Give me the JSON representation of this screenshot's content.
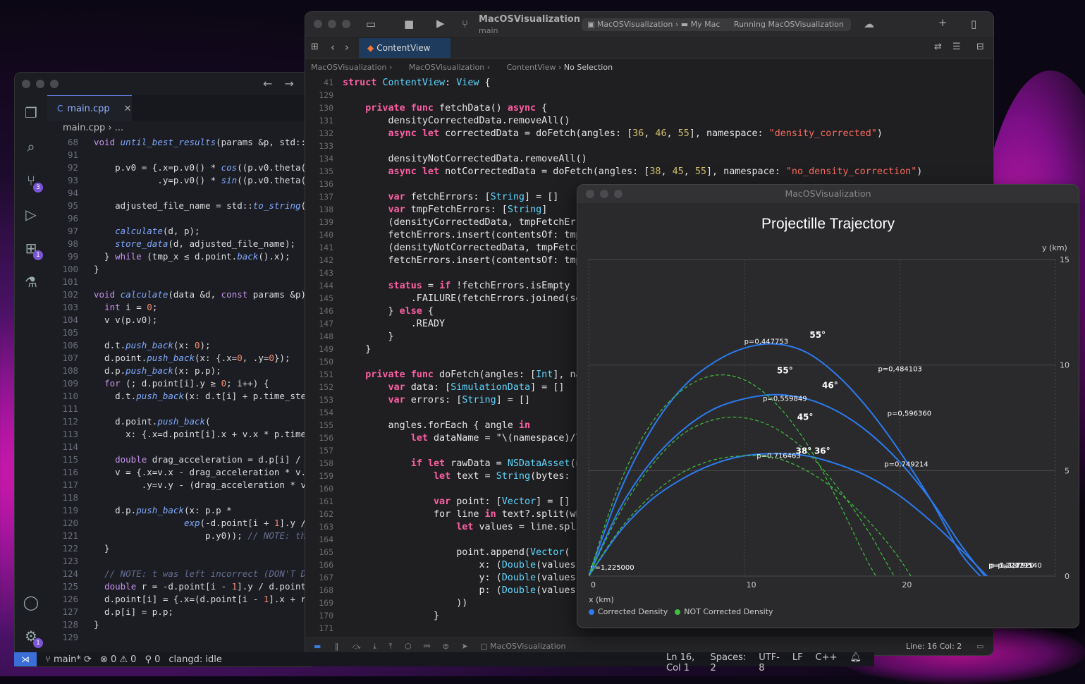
{
  "vscode": {
    "tab": {
      "name": "main.cpp"
    },
    "breadcrumb": "main.cpp  ›  ...",
    "badges": {
      "scm": "3",
      "extensions": "1",
      "settings": "1"
    },
    "code_lines": [
      {
        "n": "68",
        "t": "void until_best_results(params &p, std::st"
      },
      {
        "n": "91",
        "t": ""
      },
      {
        "n": "92",
        "t": "    p.v0 = {.x=p.v0() * cos((p.v0.theta()"
      },
      {
        "n": "93",
        "t": "            .y=p.v0() * sin((p.v0.theta()"
      },
      {
        "n": "94",
        "t": ""
      },
      {
        "n": "95",
        "t": "    adjusted_file_name = std::to_string(va"
      },
      {
        "n": "96",
        "t": ""
      },
      {
        "n": "97",
        "t": "    calculate(d, p);"
      },
      {
        "n": "98",
        "t": "    store_data(d, adjusted_file_name);"
      },
      {
        "n": "99",
        "t": "  } while (tmp_x ≤ d.point.back().x);"
      },
      {
        "n": "100",
        "t": "}"
      },
      {
        "n": "101",
        "t": ""
      },
      {
        "n": "102",
        "t": "void calculate(data &d, const params &p) {"
      },
      {
        "n": "103",
        "t": "  int i = 0;"
      },
      {
        "n": "104",
        "t": "  v v(p.v0);"
      },
      {
        "n": "105",
        "t": ""
      },
      {
        "n": "106",
        "t": "  d.t.push_back(x: 0);"
      },
      {
        "n": "107",
        "t": "  d.point.push_back(x: {.x=0, .y=0});"
      },
      {
        "n": "108",
        "t": "  d.p.push_back(x: p.p);"
      },
      {
        "n": "109",
        "t": "  for (; d.point[i].y ≥ 0; i++) {"
      },
      {
        "n": "110",
        "t": "    d.t.push_back(x: d.t[i] + p.time_step)"
      },
      {
        "n": "111",
        "t": ""
      },
      {
        "n": "112",
        "t": "    d.point.push_back("
      },
      {
        "n": "113",
        "t": "      x: {.x=d.point[i].x + v.x * p.time"
      },
      {
        "n": "114",
        "t": ""
      },
      {
        "n": "115",
        "t": "    double drag_acceleration = d.p[i] / p"
      },
      {
        "n": "116",
        "t": "    v = {.x=v.x - drag_acceleration * v.x"
      },
      {
        "n": "117",
        "t": "         .y=v.y - (drag_acceleration * v."
      },
      {
        "n": "118",
        "t": ""
      },
      {
        "n": "119",
        "t": "    d.p.push_back(x: p.p *"
      },
      {
        "n": "120",
        "t": "                 exp(-d.point[i + 1].y /"
      },
      {
        "n": "121",
        "t": "                     p.y0)); // NOTE: th"
      },
      {
        "n": "122",
        "t": "  }"
      },
      {
        "n": "123",
        "t": ""
      },
      {
        "n": "124",
        "t": "  // NOTE: t was left incorrect (DON'T DO"
      },
      {
        "n": "125",
        "t": "  double r = -d.point[i - 1].y / d.point["
      },
      {
        "n": "126",
        "t": "  d.point[i] = {.x=(d.point[i - 1].x + r"
      },
      {
        "n": "127",
        "t": "  d.p[i] = p.p;"
      },
      {
        "n": "128",
        "t": "}"
      },
      {
        "n": "129",
        "t": ""
      }
    ],
    "status": {
      "branch": "main*",
      "problems": "⊗ 0 ⚠ 0",
      "ports": "0",
      "lsp": "clangd: idle",
      "cursor": "Ln 16, Col 1",
      "spaces": "Spaces: 2",
      "encoding": "UTF-8",
      "eol": "LF",
      "language": "C++"
    }
  },
  "xcode": {
    "project": "MacOSVisualization",
    "branch": "main",
    "scheme": {
      "target": "MacOSVisualization",
      "destination": "My Mac",
      "status": "Running MacOSVisualization"
    },
    "tab": "ContentView",
    "breadcrumb": [
      "MacOSVisualization",
      "MacOSVisualization",
      "ContentView",
      "No Selection"
    ],
    "code_lines": [
      {
        "n": "41",
        "t": "struct ContentView: View {"
      },
      {
        "n": "129",
        "t": ""
      },
      {
        "n": "130",
        "t": "    private func fetchData() async {"
      },
      {
        "n": "131",
        "t": "        densityCorrectedData.removeAll()"
      },
      {
        "n": "132",
        "t": "        async let correctedData = doFetch(angles: [36, 46, 55], namespace: \"density_corrected\")"
      },
      {
        "n": "133",
        "t": ""
      },
      {
        "n": "134",
        "t": "        densityNotCorrectedData.removeAll()"
      },
      {
        "n": "135",
        "t": "        async let notCorrectedData = doFetch(angles: [38, 45, 55], namespace: \"no_density_correction\")"
      },
      {
        "n": "136",
        "t": ""
      },
      {
        "n": "137",
        "t": "        var fetchErrors: [String] = []"
      },
      {
        "n": "138",
        "t": "        var tmpFetchErrors: [String]"
      },
      {
        "n": "139",
        "t": "        (densityCorrectedData, tmpFetchErr"
      },
      {
        "n": "140",
        "t": "        fetchErrors.insert(contentsOf: tmp"
      },
      {
        "n": "141",
        "t": "        (densityNotCorrectedData, tmpFetch"
      },
      {
        "n": "142",
        "t": "        fetchErrors.insert(contentsOf: tmp"
      },
      {
        "n": "143",
        "t": ""
      },
      {
        "n": "144",
        "t": "        status = if !fetchErrors.isEmpty {"
      },
      {
        "n": "145",
        "t": "            .FAILURE(fetchErrors.joined(se"
      },
      {
        "n": "146",
        "t": "        } else {"
      },
      {
        "n": "147",
        "t": "            .READY"
      },
      {
        "n": "148",
        "t": "        }"
      },
      {
        "n": "149",
        "t": "    }"
      },
      {
        "n": "150",
        "t": ""
      },
      {
        "n": "151",
        "t": "    private func doFetch(angles: [Int], na"
      },
      {
        "n": "152",
        "t": "        var data: [SimulationData] = []"
      },
      {
        "n": "153",
        "t": "        var errors: [String] = []"
      },
      {
        "n": "154",
        "t": ""
      },
      {
        "n": "155",
        "t": "        angles.forEach { angle in"
      },
      {
        "n": "156",
        "t": "            let dataName = \"\\(namespace)/\\"
      },
      {
        "n": "157",
        "t": ""
      },
      {
        "n": "158",
        "t": "            if let rawData = NSDataAsset(n"
      },
      {
        "n": "159",
        "t": "                let text = String(bytes: r"
      },
      {
        "n": "160",
        "t": ""
      },
      {
        "n": "161",
        "t": "                var point: [Vector] = []"
      },
      {
        "n": "162",
        "t": "                for line in text?.split(wh"
      },
      {
        "n": "163",
        "t": "                    let values = line.spli"
      },
      {
        "n": "164",
        "t": ""
      },
      {
        "n": "165",
        "t": "                    point.append(Vector("
      },
      {
        "n": "166",
        "t": "                        x: (Double(values["
      },
      {
        "n": "167",
        "t": "                        y: (Double(values["
      },
      {
        "n": "168",
        "t": "                        p: (Double(values["
      },
      {
        "n": "169",
        "t": "                    ))"
      },
      {
        "n": "170",
        "t": "                }"
      },
      {
        "n": "171",
        "t": ""
      }
    ],
    "bottom": {
      "target": "MacOSVisualization",
      "position": "Line: 16  Col: 2"
    }
  },
  "simulation": {
    "window_title": "MacOSVisualization",
    "chart_data": {
      "type": "line",
      "title": "Projectille Trajectory",
      "xlabel": "x (km)",
      "ylabel": "y (km)",
      "xlim": [
        0,
        30
      ],
      "ylim": [
        0,
        15
      ],
      "xticks": [
        "0",
        "10",
        "20"
      ],
      "yticks": [
        "0",
        "5",
        "10",
        "15"
      ],
      "grid": true,
      "legend": "bottom-left",
      "colors": {
        "corrected": "#2b7bf0",
        "not_corrected": "#3fbf3f"
      },
      "series": [
        {
          "name": "Corrected Density",
          "angle": "55°",
          "style": "solid",
          "x": [
            0,
            2,
            4,
            6,
            8,
            10,
            12,
            14,
            16,
            18,
            20,
            22,
            24,
            26
          ],
          "y": [
            0,
            4.0,
            6.9,
            8.9,
            10.1,
            10.8,
            11.0,
            10.6,
            9.5,
            7.9,
            5.9,
            3.6,
            1.0,
            -0.6
          ],
          "pressure_labels": [
            {
              "x": 0.1,
              "y": 0.3,
              "text": "p=1,225000"
            },
            {
              "x": 10.0,
              "y": 11.0,
              "text": "p=0,447753"
            },
            {
              "x": 18.6,
              "y": 9.7,
              "text": "p=0,484103"
            },
            {
              "x": 25.7,
              "y": 0.4,
              "text": "p=1,224791"
            }
          ]
        },
        {
          "name": "Corrected Density",
          "angle": "46°",
          "style": "solid",
          "x": [
            0,
            2,
            4,
            6,
            8,
            10,
            12,
            14,
            16,
            18,
            20,
            22,
            24,
            26
          ],
          "y": [
            0,
            3.2,
            5.4,
            6.9,
            7.9,
            8.4,
            8.6,
            8.4,
            7.8,
            6.8,
            5.4,
            3.6,
            1.4,
            -0.5
          ],
          "pressure_labels": [
            {
              "x": 11.2,
              "y": 8.3,
              "text": "p=0,559849"
            },
            {
              "x": 19.2,
              "y": 7.6,
              "text": "p=0,596360"
            },
            {
              "x": 25.8,
              "y": 0.4,
              "text": "p=1,227920"
            }
          ]
        },
        {
          "name": "Corrected Density",
          "angle": "36°",
          "style": "solid",
          "x": [
            0,
            2,
            4,
            6,
            8,
            10,
            12,
            14,
            16,
            18,
            20,
            22,
            24,
            26
          ],
          "y": [
            0,
            2.1,
            3.6,
            4.6,
            5.3,
            5.7,
            5.8,
            5.7,
            5.3,
            4.7,
            3.8,
            2.6,
            1.2,
            -0.3
          ],
          "pressure_labels": [
            {
              "x": 10.8,
              "y": 5.6,
              "text": "p=0,716463"
            },
            {
              "x": 19.0,
              "y": 5.2,
              "text": "p=0,749214"
            },
            {
              "x": 26.3,
              "y": 0.4,
              "text": "p=1,221540"
            }
          ]
        },
        {
          "name": "NOT Corrected Density",
          "angle": "55°",
          "style": "dashed",
          "x": [
            0,
            2,
            4,
            6,
            8,
            10,
            12,
            14,
            16,
            18,
            19.5
          ],
          "y": [
            0,
            4.4,
            7.2,
            8.8,
            9.5,
            9.3,
            8.2,
            6.3,
            3.6,
            0.6,
            -1.2
          ]
        },
        {
          "name": "NOT Corrected Density",
          "angle": "45°",
          "style": "dashed",
          "x": [
            0,
            2,
            4,
            6,
            8,
            10,
            12,
            14,
            16,
            18,
            20,
            22
          ],
          "y": [
            0,
            3.0,
            5.2,
            6.7,
            7.4,
            7.5,
            7.0,
            5.9,
            4.2,
            2.1,
            -0.4,
            -2.0
          ]
        },
        {
          "name": "NOT Corrected Density",
          "angle": "38°",
          "style": "dashed",
          "x": [
            0,
            2,
            4,
            6,
            8,
            10,
            12,
            14,
            16,
            18,
            20,
            22
          ],
          "y": [
            0,
            2.2,
            3.8,
            4.9,
            5.5,
            5.7,
            5.6,
            5.0,
            4.0,
            2.6,
            0.8,
            -1.6
          ]
        }
      ],
      "angle_labels": [
        {
          "x": 14.2,
          "y": 11.3,
          "text": "55°"
        },
        {
          "x": 12.1,
          "y": 9.6,
          "text": "55°"
        },
        {
          "x": 15.0,
          "y": 8.9,
          "text": "46°"
        },
        {
          "x": 13.4,
          "y": 7.4,
          "text": "45°"
        },
        {
          "x": 13.3,
          "y": 5.8,
          "text": "38°"
        },
        {
          "x": 14.5,
          "y": 5.8,
          "text": "36°"
        }
      ]
    }
  }
}
